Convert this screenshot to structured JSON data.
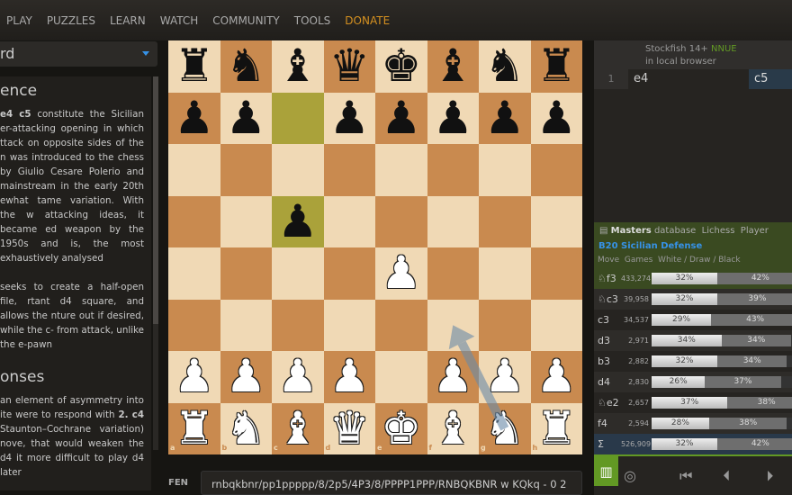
{
  "nav": {
    "items": [
      "PLAY",
      "PUZZLES",
      "LEARN",
      "WATCH",
      "COMMUNITY",
      "TOOLS"
    ],
    "donate": "DONATE"
  },
  "left": {
    "select_value": "rd",
    "h1": "ence",
    "p1_bold": "e4 c5",
    "p1": " constitute the Sicilian er-attacking opening in which ttack on opposite sides of the n was introduced to the chess by Giulio Cesare Polerio and mainstream in the early 20th ewhat tame variation. With the w attacking ideas, it became ed weapon by the 1950s and is, the most exhaustively analysed",
    "p2": "seeks to create a half-open file, rtant d4 square, and allows the nture out if desired, while the c- from attack, unlike the e-pawn",
    "h2": "onses",
    "p3a": "an element of asymmetry into ite were to respond with ",
    "p3b": "2. c4",
    "p3c": " Staunton–Cochrane variation) nove, that would weaken the d4 it more difficult to play d4 later"
  },
  "board": {
    "fen": "rnbqkbnr/pp1ppppp/8/2p5/4P3/8/PPPP1PPP/RNBQKBNR w KQkq - 0 2",
    "highlight": [
      "c7",
      "c5"
    ],
    "arrow": {
      "from": "g1",
      "to": "f3"
    },
    "files": [
      "a",
      "b",
      "c",
      "d",
      "e",
      "f",
      "g",
      "h"
    ],
    "ranks": [
      "1",
      "2",
      "3",
      "4",
      "5",
      "6",
      "7",
      "8"
    ],
    "colors": {
      "light": "#f0d9b5",
      "dark": "#c98a4f",
      "highlight": "#aaa23a",
      "arrow": "#6a8aa8"
    }
  },
  "fen_label": "FEN",
  "fen_value": "rnbqkbnr/pp1ppppp/8/2p5/4P3/8/PPPP1PPP/RNBQKBNR w KQkq - 0 2",
  "engine": {
    "name": "Stockfish 14+",
    "nnue": "NNUE",
    "location": "in local browser"
  },
  "moves": {
    "num": "1",
    "white": "e4",
    "black": "c5"
  },
  "explorer": {
    "tabs": {
      "masters": "Masters",
      "masters_rest": "database",
      "lichess": "Lichess",
      "player": "Player"
    },
    "opening": "B20 Sicilian Defense",
    "cols": "Move  Games  White / Draw / Black",
    "rows": [
      {
        "move": "♘f3",
        "games": "433,274",
        "white": 32,
        "draw": 42
      },
      {
        "move": "♘c3",
        "games": "39,958",
        "white": 32,
        "draw": 39
      },
      {
        "move": "c3",
        "games": "34,537",
        "white": 29,
        "draw": 43
      },
      {
        "move": "d3",
        "games": "2,971",
        "white": 34,
        "draw": 34
      },
      {
        "move": "b3",
        "games": "2,882",
        "white": 32,
        "draw": 34
      },
      {
        "move": "d4",
        "games": "2,830",
        "white": 26,
        "draw": 37
      },
      {
        "move": "♘e2",
        "games": "2,657",
        "white": 37,
        "draw": 38
      },
      {
        "move": "f4",
        "games": "2,594",
        "white": 28,
        "draw": 38
      }
    ],
    "total": {
      "move": "Σ",
      "games": "526,909",
      "white": 32,
      "draw": 42
    }
  }
}
